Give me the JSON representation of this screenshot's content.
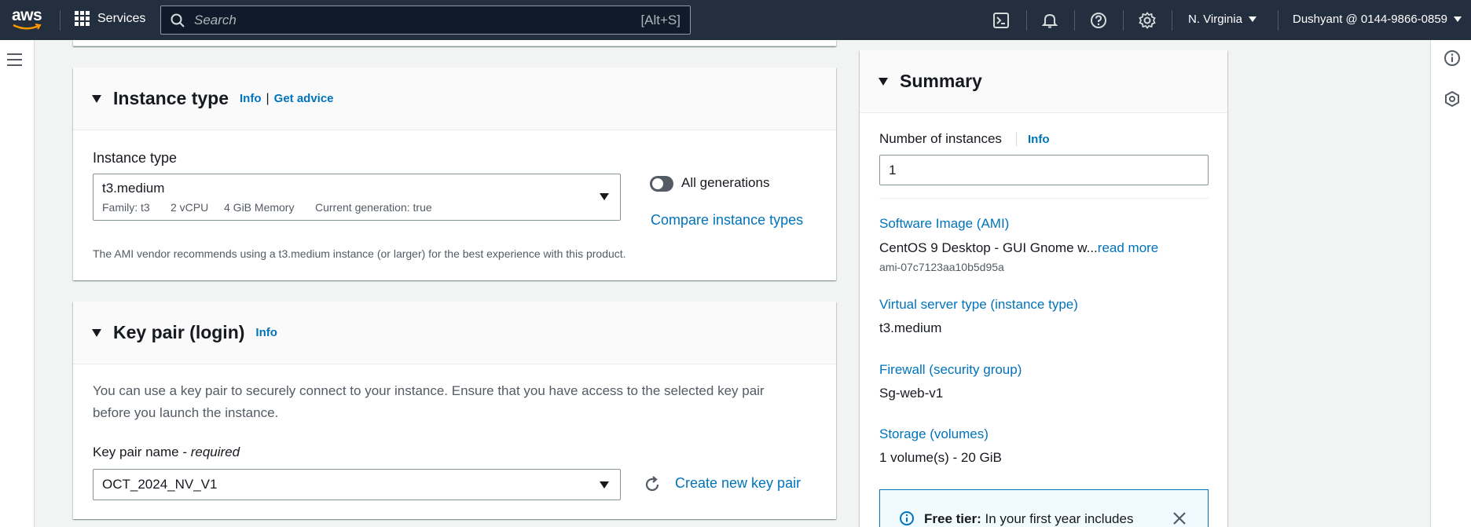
{
  "topnav": {
    "logo_text": "aws",
    "services_label": "Services",
    "search_placeholder": "Search",
    "search_shortcut": "[Alt+S]",
    "region": "N. Virginia",
    "account": "Dushyant @ 0144-9866-0859"
  },
  "instance_type": {
    "title": "Instance type",
    "info": "Info",
    "separator": "|",
    "get_advice": "Get advice",
    "field_label": "Instance type",
    "selected": "t3.medium",
    "family": "Family: t3",
    "vcpu": "2 vCPU",
    "memory": "4 GiB Memory",
    "current_generation": "Current generation: true",
    "all_generations": "All generations",
    "compare": "Compare instance types",
    "note": "The AMI vendor recommends using a t3.medium instance (or larger) for the best experience with this product."
  },
  "key_pair": {
    "title": "Key pair (login)",
    "info": "Info",
    "description_line1": "You can use a key pair to securely connect to your instance. Ensure that you have access to the selected key pair",
    "description_line2": "before you launch the instance.",
    "field_label": "Key pair name - ",
    "field_required": "required",
    "selected": "OCT_2024_NV_V1",
    "create_new": "Create new key pair"
  },
  "summary": {
    "title": "Summary",
    "num_instances_label": "Number of instances",
    "info": "Info",
    "num_instances_value": "1",
    "ami_label": "Software Image (AMI)",
    "ami_value": "CentOS 9 Desktop - GUI Gnome w...",
    "read_more": "read more",
    "ami_id": "ami-07c7123aa10b5d95a",
    "instance_type_label": "Virtual server type (instance type)",
    "instance_type_value": "t3.medium",
    "firewall_label": "Firewall (security group)",
    "firewall_value": "Sg-web-v1",
    "storage_label": "Storage (volumes)",
    "storage_value": "1 volume(s) - 20 GiB",
    "free_tier_bold": "Free tier:",
    "free_tier_text": " In your first year includes"
  }
}
